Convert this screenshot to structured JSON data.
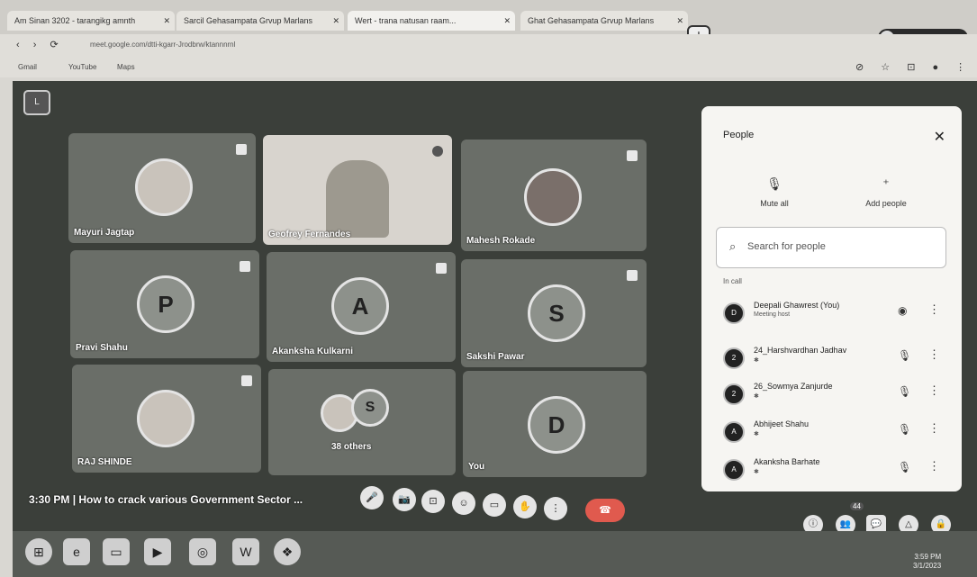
{
  "browser": {
    "tabs": [
      {
        "label": "Am Sinan 3202 - tarangikg amnth"
      },
      {
        "label": "Sarcil Gehasampata Grvup Marlans"
      },
      {
        "label": "Wert - trana natusan raam..."
      },
      {
        "label": "Ghat Gehasampata Grvup Marlans"
      }
    ],
    "new_tab": "+",
    "profile": "Lone Grand Nav",
    "nav": "‹ › ⟳",
    "url": "meet.google.com/dtti-kgarr-Jrodbrw/ktannnrnl",
    "bookmarks": [
      "Gmail",
      "YouTube",
      "Maps"
    ],
    "toolbar_icons": "⊘ ☆ ⊡ ● ⋮"
  },
  "meet": {
    "corner_label": "L",
    "tiles": [
      {
        "name": "Mayuri Jagtap",
        "avatar": ""
      },
      {
        "name": "Geofrey Fernandes",
        "avatar": ""
      },
      {
        "name": "Mahesh Rokade",
        "avatar": ""
      },
      {
        "name": "Pravi Shahu",
        "avatar": "P"
      },
      {
        "name": "Akanksha Kulkarni",
        "avatar": "A"
      },
      {
        "name": "Sakshi Pawar",
        "avatar": "S"
      },
      {
        "name": "RAJ SHINDE",
        "avatar": ""
      },
      {
        "name": "38 others",
        "avatar": "S"
      },
      {
        "name": "You",
        "avatar": "D"
      }
    ],
    "meeting_time": "3:30 PM",
    "meeting_title": "How to crack various Government Sector ...",
    "controls": [
      "🎤",
      "📷",
      "⊡",
      "☺",
      "▭",
      "✋",
      "⋮"
    ],
    "end_call": "☎",
    "right_controls": [
      "ⓘ",
      "👥",
      "💬",
      "△",
      "🔒"
    ],
    "participant_count": "44"
  },
  "people_panel": {
    "title": "People",
    "close": "✕",
    "mute_all": "Mute all",
    "add_people": "Add people",
    "search_placeholder": "Search for people",
    "section": "In call",
    "participants": [
      {
        "name": "Deepali Ghawrest (You)",
        "sub": "Meeting host",
        "initial": "D"
      },
      {
        "name": "24_Harshvardhan Jadhav",
        "sub": "✱",
        "initial": "2"
      },
      {
        "name": "26_Sowmya Zanjurde",
        "sub": "✱",
        "initial": "2"
      },
      {
        "name": "Abhijeet Shahu",
        "sub": "✱",
        "initial": "A"
      },
      {
        "name": "Akanksha Barhate",
        "sub": "✱",
        "initial": "A"
      }
    ]
  },
  "taskbar": {
    "apps": [
      "⊞",
      "e",
      "▭",
      "▶",
      "◎",
      "W",
      "❖"
    ],
    "time": "3:59 PM",
    "date": "3/1/2023"
  }
}
